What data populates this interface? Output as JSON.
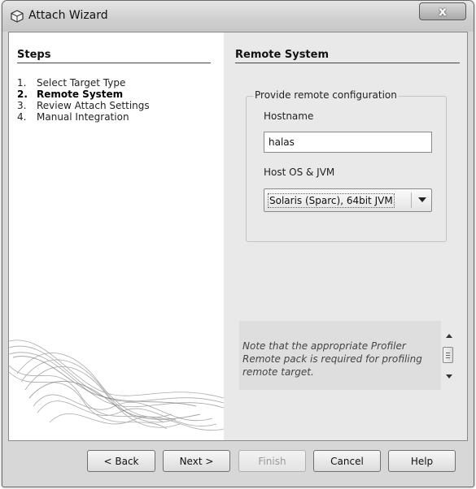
{
  "window": {
    "title": "Attach Wizard",
    "close_symbol": "x"
  },
  "steps": {
    "header": "Steps",
    "items": [
      {
        "number": "1.",
        "label": "Select Target Type",
        "current": false
      },
      {
        "number": "2.",
        "label": "Remote System",
        "current": true
      },
      {
        "number": "3.",
        "label": "Review Attach Settings",
        "current": false
      },
      {
        "number": "4.",
        "label": "Manual Integration",
        "current": false
      }
    ]
  },
  "panel": {
    "title": "Remote System",
    "group_title": "Provide remote configuration",
    "hostname_label": "Hostname",
    "hostname_value": "halas",
    "os_label": "Host OS & JVM",
    "os_value": "Solaris (Sparc), 64bit JVM",
    "note": "Note that the appropriate Profiler Remote pack is required for profiling remote target."
  },
  "buttons": {
    "back": "< Back",
    "next": "Next >",
    "finish": "Finish",
    "cancel": "Cancel",
    "help": "Help"
  },
  "icons": {
    "title_icon": "netbeans-cube-icon",
    "close_icon": "close-icon",
    "dropdown_icon": "chevron-down-icon"
  },
  "colors": {
    "window_bg": "#d7d7d7",
    "right_pane_bg": "#e9e9e9",
    "note_bg": "#dedede"
  }
}
